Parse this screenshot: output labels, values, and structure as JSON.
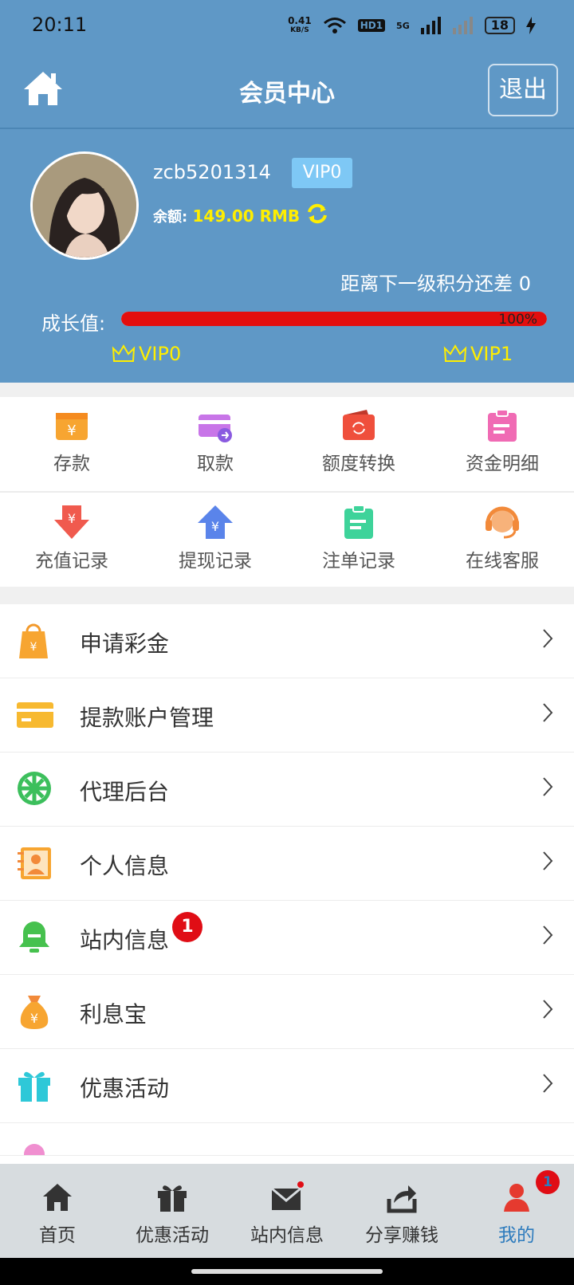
{
  "status_bar": {
    "time": "20:11",
    "net_speed_value": "0.41",
    "net_speed_unit": "KB/S",
    "hd": "HD1",
    "network": "5G",
    "battery": "18"
  },
  "header": {
    "title": "会员中心",
    "logout_label": "退出"
  },
  "profile": {
    "username": "zcb5201314",
    "vip_badge": "VIP0",
    "balance_label": "余额:",
    "balance_value": "149.00 RMB",
    "next_level_text": "距离下一级积分还差 0",
    "growth_label": "成长值:",
    "growth_percent_label": "100%",
    "growth_fraction": 1.0,
    "current_level": "VIP0",
    "next_level": "VIP1"
  },
  "quick_actions_row1": [
    {
      "label": "存款",
      "icon": "deposit-icon"
    },
    {
      "label": "取款",
      "icon": "withdraw-card-icon"
    },
    {
      "label": "额度转换",
      "icon": "transfer-icon"
    },
    {
      "label": "资金明细",
      "icon": "clipboard-icon"
    }
  ],
  "quick_actions_row2": [
    {
      "label": "充值记录",
      "icon": "recharge-arrow-icon"
    },
    {
      "label": "提现记录",
      "icon": "withdraw-arrow-icon"
    },
    {
      "label": "注单记录",
      "icon": "order-clipboard-icon"
    },
    {
      "label": "在线客服",
      "icon": "headset-icon"
    }
  ],
  "menu": [
    {
      "label": "申请彩金",
      "icon": "shopping-bag-icon"
    },
    {
      "label": "提款账户管理",
      "icon": "bank-card-icon"
    },
    {
      "label": "代理后台",
      "icon": "wheel-icon"
    },
    {
      "label": "个人信息",
      "icon": "contact-card-icon"
    },
    {
      "label": "站内信息",
      "icon": "bell-icon",
      "badge": "1"
    },
    {
      "label": "利息宝",
      "icon": "money-bag-icon"
    },
    {
      "label": "优惠活动",
      "icon": "gift-icon"
    }
  ],
  "tabbar": [
    {
      "label": "首页",
      "icon": "home-icon"
    },
    {
      "label": "优惠活动",
      "icon": "gift-icon"
    },
    {
      "label": "站内信息",
      "icon": "mail-icon"
    },
    {
      "label": "分享赚钱",
      "icon": "share-icon"
    },
    {
      "label": "我的",
      "icon": "user-icon",
      "active": true,
      "badge": "1"
    }
  ],
  "colors": {
    "header_bg": "#5f98c6",
    "accent_yellow": "#ffee00",
    "progress_red": "#e30e0e",
    "active_tab": "#2d7bbd",
    "badge_red": "#e00d15"
  }
}
